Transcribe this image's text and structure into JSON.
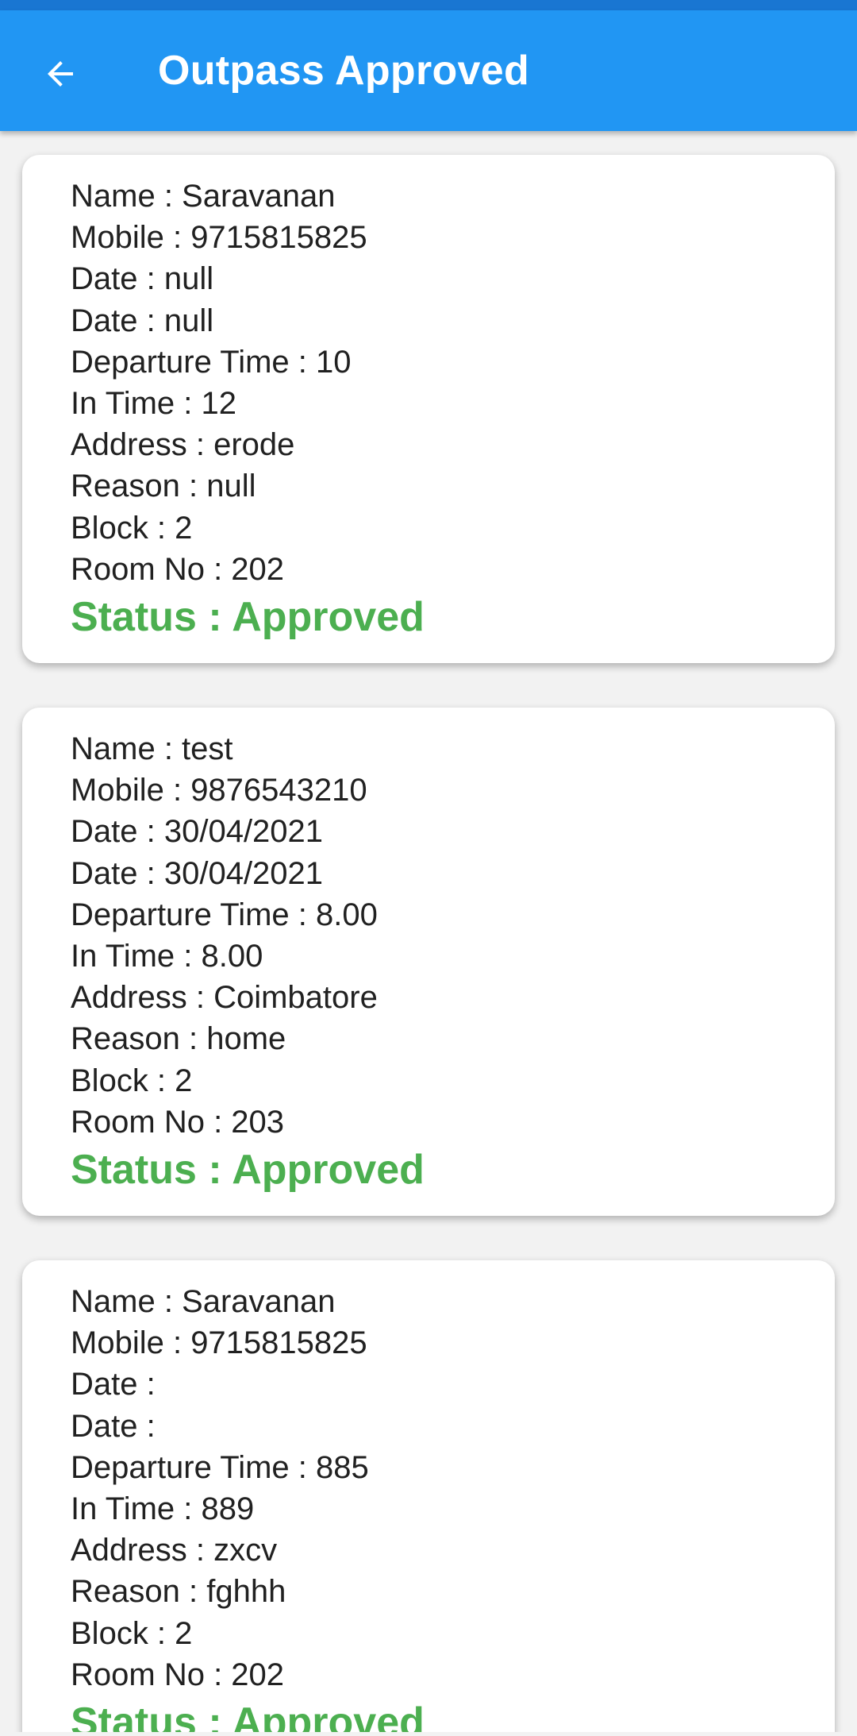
{
  "app_bar": {
    "title": "Outpass Approved",
    "back_icon": "arrow-back-icon"
  },
  "labels": {
    "name": "Name",
    "mobile": "Mobile",
    "date": "Date",
    "departure_time": "Departure Time",
    "in_time": "In Time",
    "address": "Address",
    "reason": "Reason",
    "block": "Block",
    "room_no": "Room No",
    "status": "Status",
    "separator": " : "
  },
  "colors": {
    "app_bar": "#2196f3",
    "status_approved": "#4caf50"
  },
  "outpasses": [
    {
      "name": "Saravanan",
      "mobile": "9715815825",
      "date_out": "null",
      "date_in": "null",
      "departure_time": "10",
      "in_time": "12",
      "address": "erode",
      "reason": "null",
      "block": "2",
      "room_no": "202",
      "status": "Approved"
    },
    {
      "name": "test",
      "mobile": "9876543210",
      "date_out": "30/04/2021",
      "date_in": "30/04/2021",
      "departure_time": "8.00",
      "in_time": "8.00",
      "address": "Coimbatore",
      "reason": "home",
      "block": "2",
      "room_no": "203",
      "status": "Approved"
    },
    {
      "name": "Saravanan",
      "mobile": "9715815825",
      "date_out": "",
      "date_in": "",
      "departure_time": "885",
      "in_time": "889",
      "address": "zxcv",
      "reason": "fghhh",
      "block": "2",
      "room_no": "202",
      "status": "Approved"
    }
  ]
}
